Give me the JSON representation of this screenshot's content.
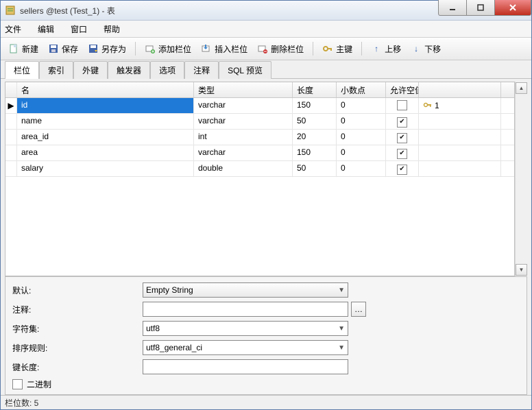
{
  "window": {
    "title": "sellers @test (Test_1) - 表"
  },
  "menu": {
    "file": "文件",
    "edit": "编辑",
    "window": "窗口",
    "help": "帮助"
  },
  "toolbar": {
    "new": "新建",
    "save": "保存",
    "saveas": "另存为",
    "addfield": "添加栏位",
    "insertfield": "插入栏位",
    "deletefield": "删除栏位",
    "primarykey": "主键",
    "moveup": "上移",
    "movedown": "下移"
  },
  "tabs": {
    "fields": "栏位",
    "indexes": "索引",
    "fks": "外键",
    "triggers": "触发器",
    "options": "选项",
    "comment": "注释",
    "sqlpreview": "SQL 预览"
  },
  "grid": {
    "head": {
      "name": "名",
      "type": "类型",
      "length": "长度",
      "decimals": "小数点",
      "allownull": "允许空值 ("
    },
    "rows": [
      {
        "name": "id",
        "type": "varchar",
        "length": "150",
        "decimals": "0",
        "allownull": false,
        "keylabel": "1",
        "selected": true
      },
      {
        "name": "name",
        "type": "varchar",
        "length": "50",
        "decimals": "0",
        "allownull": true
      },
      {
        "name": "area_id",
        "type": "int",
        "length": "20",
        "decimals": "0",
        "allownull": true
      },
      {
        "name": "area",
        "type": "varchar",
        "length": "150",
        "decimals": "0",
        "allownull": true
      },
      {
        "name": "salary",
        "type": "double",
        "length": "50",
        "decimals": "0",
        "allownull": true
      }
    ]
  },
  "detail": {
    "default_label": "默认:",
    "default_value": "Empty String",
    "comment_label": "注释:",
    "comment_value": "",
    "charset_label": "字符集:",
    "charset_value": "utf8",
    "collation_label": "排序规则:",
    "collation_value": "utf8_general_ci",
    "keylen_label": "键长度:",
    "keylen_value": "",
    "binary_label": "二进制"
  },
  "status": {
    "text": "栏位数: 5"
  }
}
